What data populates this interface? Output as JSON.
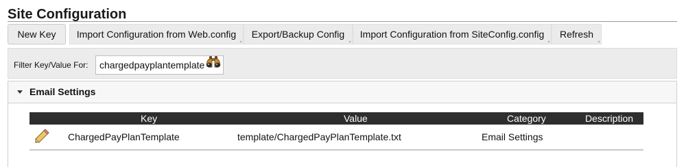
{
  "page": {
    "title": "Site Configuration"
  },
  "toolbar": {
    "buttons": [
      {
        "label": "New Key"
      },
      {
        "label": "Import Configuration from Web.config"
      },
      {
        "label": "Export/Backup Config"
      },
      {
        "label": "Import Configuration from SiteConfig.config"
      },
      {
        "label": "Refresh"
      }
    ]
  },
  "filter": {
    "label": "Filter Key/Value For:",
    "value": "chargedpayplantemplate",
    "search_icon": "binoculars-icon"
  },
  "section": {
    "title": "Email Settings",
    "expanded": true,
    "columns": {
      "key": "Key",
      "value": "Value",
      "category": "Category",
      "description": "Description"
    },
    "rows": [
      {
        "key": "ChargedPayPlanTemplate",
        "value": "template/ChargedPayPlanTemplate.txt",
        "category": "Email Settings",
        "description": "",
        "edit_icon": "pencil-icon"
      }
    ]
  },
  "colors": {
    "grid_header_bg": "#2e2e2e",
    "toolbar_bg": "#ebebeb"
  }
}
